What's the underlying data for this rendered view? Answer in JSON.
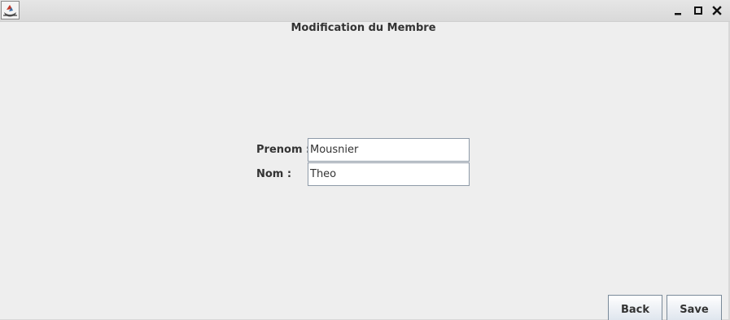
{
  "window": {
    "icons": {
      "app": "java-cup-icon",
      "minimize": "minimize-icon",
      "maximize": "maximize-icon",
      "close": "close-icon"
    }
  },
  "form": {
    "title": "Modification du Membre",
    "prenom_label": "Prenom :",
    "prenom_value": "Mousnier",
    "nom_label": "Nom :",
    "nom_value": "Theo"
  },
  "actions": {
    "back_label": "Back",
    "save_label": "Save"
  },
  "colors": {
    "background": "#eeeeee",
    "titlebar": "#dddddd",
    "field_border": "#8e9aa8",
    "button_border": "#7a8a99"
  }
}
